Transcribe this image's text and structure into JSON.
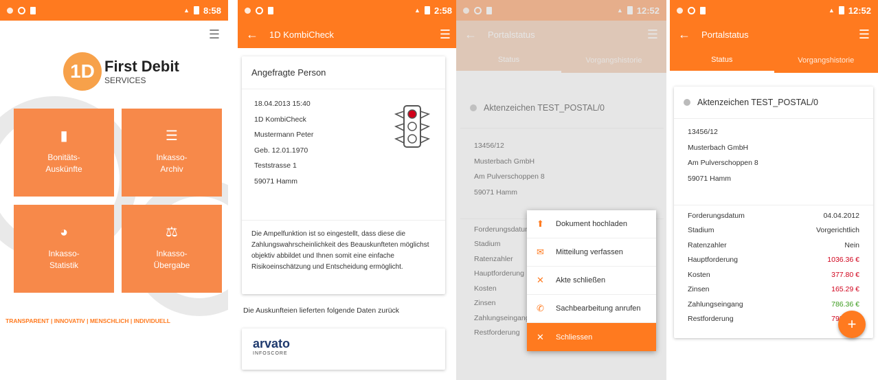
{
  "screen1": {
    "status": {
      "time": "8:58"
    },
    "brand": {
      "mark": "1D",
      "name": "First Debit",
      "sub": "SERVICES"
    },
    "tiles": [
      {
        "l1": "Bonitäts-",
        "l2": "Auskünfte",
        "icon": "chip-icon",
        "glyph": "▮"
      },
      {
        "l1": "Inkasso-",
        "l2": "Archiv",
        "icon": "list-icon",
        "glyph": "☰"
      },
      {
        "l1": "Inkasso-",
        "l2": "Statistik",
        "icon": "pie-chart-icon",
        "glyph": "◕"
      },
      {
        "l1": "Inkasso-",
        "l2": "Übergabe",
        "icon": "scales-icon",
        "glyph": "⚖"
      }
    ],
    "tagline": "TRANSPARENT | INNOVATIV | MENSCHLICH | INDIVIDUELL"
  },
  "screen2": {
    "status": {
      "time": "2:58"
    },
    "title": "1D KombiCheck",
    "card_title": "Angefragte Person",
    "details": [
      "18.04.2013 15:40",
      "1D KombiCheck",
      "Mustermann Peter",
      "Geb. 12.01.1970",
      "Teststrasse 1",
      "59071 Hamm"
    ],
    "description": "Die Ampelfunktion ist so eingestellt, dass diese die Zahlungswahrscheinlichkeit des Beauskunfteten möglichst objektiv abbildet und Ihnen somit eine einfache Risikoeinschätzung und Entscheidung ermöglicht.",
    "section_label": "Die Auskunfteien lieferten folgende Daten zurück",
    "provider": {
      "name": "arvato",
      "sub": "INFOSCORE"
    }
  },
  "screen3": {
    "status": {
      "time": "12:52"
    },
    "title": "Portalstatus",
    "tabs": [
      "Status",
      "Vorgangshistorie"
    ],
    "case": "Aktenzeichen TEST_POSTAL/0",
    "address": [
      "13456/12",
      "Musterbach GmbH",
      "Am Pulverschoppen 8",
      "59071 Hamm"
    ],
    "labels": [
      "Forderungsdatum",
      "Stadium",
      "Ratenzahler",
      "Hauptforderung",
      "Kosten",
      "Zinsen",
      "Zahlungseingang",
      "Restforderung"
    ],
    "menu": [
      {
        "label": "Dokument hochladen",
        "icon": "upload-icon",
        "glyph": "⬆"
      },
      {
        "label": "Mitteilung verfassen",
        "icon": "mail-icon",
        "glyph": "✉"
      },
      {
        "label": "Akte schließen",
        "icon": "close-icon",
        "glyph": "✕"
      },
      {
        "label": "Sachbearbeitung anrufen",
        "icon": "phone-icon",
        "glyph": "✆"
      },
      {
        "label": "Schliessen",
        "icon": "close-icon",
        "glyph": "✕"
      }
    ]
  },
  "screen4": {
    "status": {
      "time": "12:52"
    },
    "title": "Portalstatus",
    "tabs": [
      "Status",
      "Vorgangshistorie"
    ],
    "case": "Aktenzeichen TEST_POSTAL/0",
    "address": [
      "13456/12",
      "Musterbach GmbH",
      "Am Pulverschoppen 8",
      "59071 Hamm"
    ],
    "rows": [
      {
        "label": "Forderungsdatum",
        "value": "04.04.2012",
        "tone": ""
      },
      {
        "label": "Stadium",
        "value": "Vorgerichtlich",
        "tone": ""
      },
      {
        "label": "Ratenzahler",
        "value": "Nein",
        "tone": ""
      },
      {
        "label": "Hauptforderung",
        "value": "1036.36 €",
        "tone": "red"
      },
      {
        "label": "Kosten",
        "value": "377.80 €",
        "tone": "red"
      },
      {
        "label": "Zinsen",
        "value": "165.29 €",
        "tone": "red"
      },
      {
        "label": "Zahlungseingang",
        "value": "786.36 €",
        "tone": "green"
      },
      {
        "label": "Restforderung",
        "value": "793.09 €",
        "tone": "red"
      }
    ],
    "fab": "+"
  },
  "colors": {
    "accent": "#ff7a1f",
    "tile": "#f7894a",
    "red": "#d0021b",
    "green": "#3a9a1c"
  }
}
